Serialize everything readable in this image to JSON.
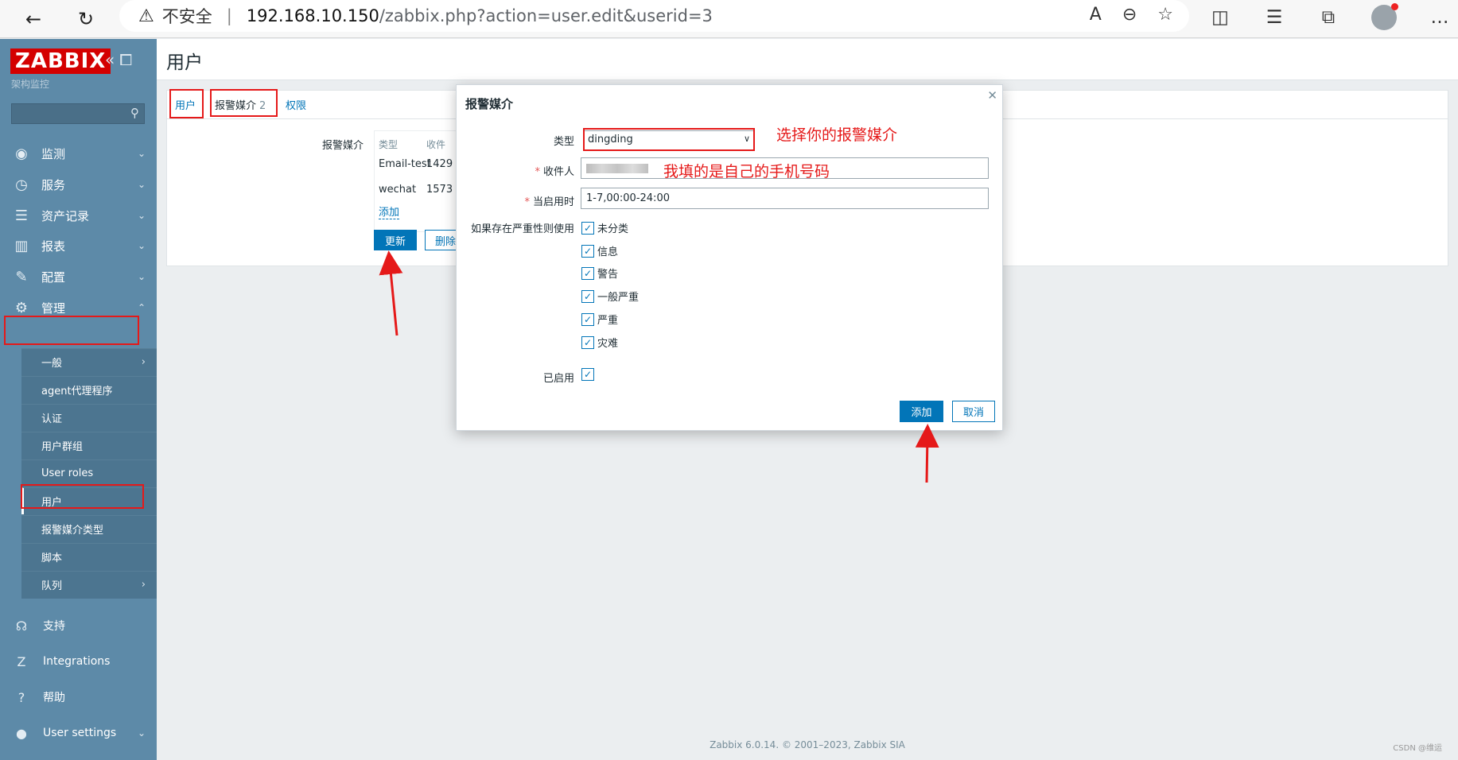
{
  "browser": {
    "insecure_label": "不安全",
    "separator": "|",
    "url_host": "192.168.10.150",
    "url_path": "/zabbix.php?action=user.edit&userid=3"
  },
  "sidebar": {
    "logo": "ZABBIX",
    "subtitle": "架构监控",
    "main_menu": [
      {
        "label": "监测",
        "icon": "eye-icon"
      },
      {
        "label": "服务",
        "icon": "stopwatch-icon"
      },
      {
        "label": "资产记录",
        "icon": "list-icon"
      },
      {
        "label": "报表",
        "icon": "bar-chart-icon"
      },
      {
        "label": "配置",
        "icon": "wrench-icon"
      },
      {
        "label": "管理",
        "icon": "gear-icon"
      }
    ],
    "admin_submenu": [
      "一般",
      "agent代理程序",
      "认证",
      "用户群组",
      "User roles",
      "用户",
      "报警媒介类型",
      "脚本",
      "队列"
    ],
    "bottom_menu": [
      {
        "label": "支持",
        "icon": "headset-icon"
      },
      {
        "label": "Integrations",
        "icon": "integrations-icon"
      },
      {
        "label": "帮助",
        "icon": "help-icon"
      },
      {
        "label": "User settings",
        "icon": "user-icon"
      }
    ]
  },
  "page": {
    "title": "用户",
    "tabs": {
      "user": "用户",
      "media": "报警媒介",
      "media_count": "2",
      "permissions": "权限"
    },
    "media_label": "报警媒介",
    "media_table": {
      "headers": [
        "类型",
        "收件"
      ],
      "rows": [
        [
          "Email-test",
          "1429"
        ],
        [
          "wechat",
          "1573"
        ]
      ],
      "add_link": "添加"
    },
    "update_button": "更新",
    "delete_button": "删除"
  },
  "dialog": {
    "title": "报警媒介",
    "type_label": "类型",
    "type_value": "dingding",
    "recipient_label": "收件人",
    "active_label": "当启用时",
    "active_value": "1-7,00:00-24:00",
    "severity_label": "如果存在严重性则使用",
    "severities": [
      "未分类",
      "信息",
      "警告",
      "一般严重",
      "严重",
      "灾难"
    ],
    "enabled_label": "已启用",
    "add_button": "添加",
    "cancel_button": "取消"
  },
  "annotations": {
    "select_media": "选择你的报警媒介",
    "phone_note": "我填的是自己的手机号码"
  },
  "footer": {
    "text": "Zabbix 6.0.14. © 2001–2023, Zabbix SIA",
    "watermark": "CSDN @维运"
  },
  "colors": {
    "accent": "#0275b8",
    "sidebar": "#5d8aa8",
    "annotation_red": "#e51919",
    "logo_red": "#d40000"
  }
}
